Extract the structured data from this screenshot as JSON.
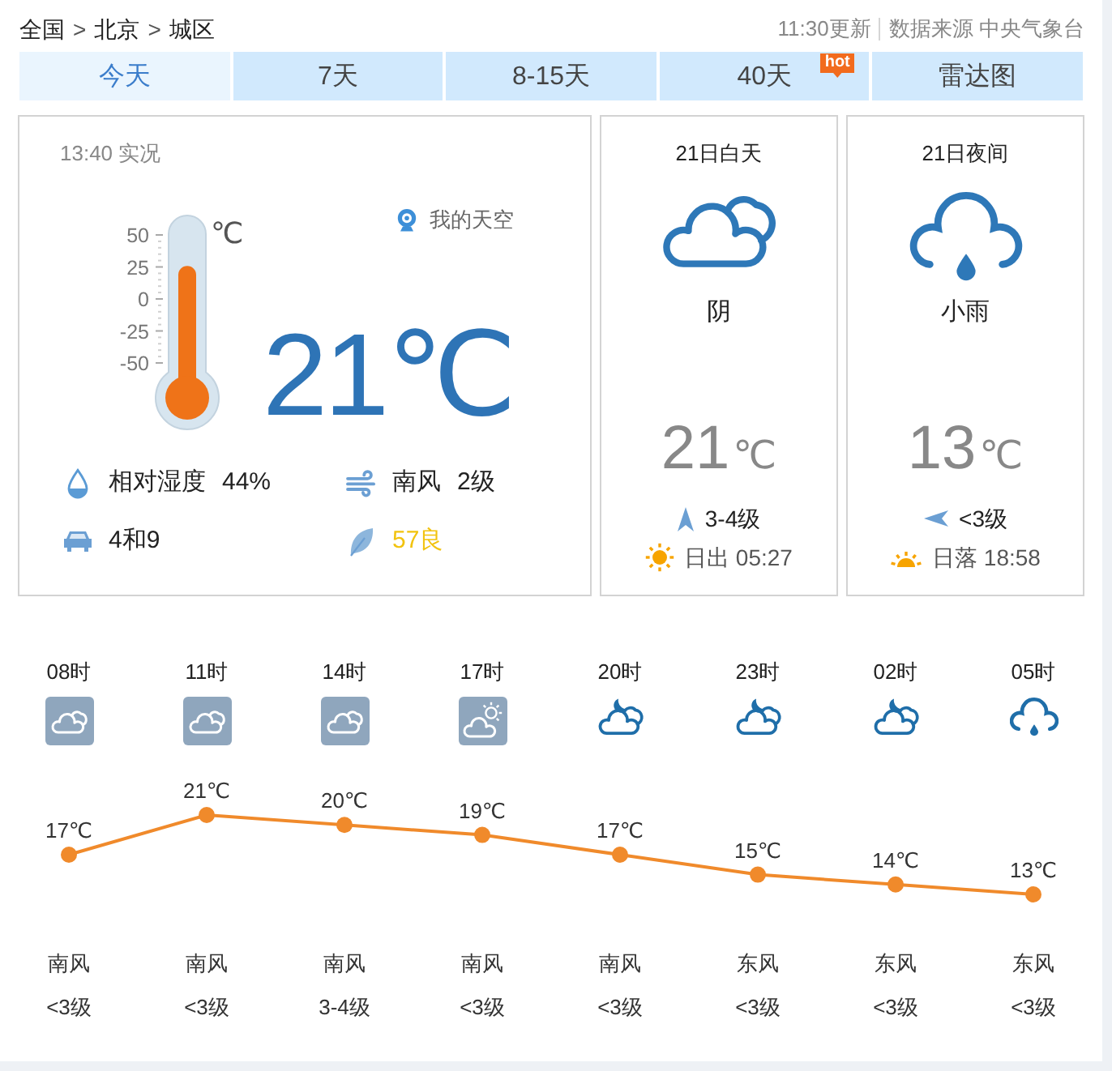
{
  "header": {
    "breadcrumb": [
      {
        "kind": "link",
        "text": "全国"
      },
      {
        "kind": "separator",
        "text": ">"
      },
      {
        "kind": "link",
        "text": "北京"
      },
      {
        "kind": "separator",
        "text": ">"
      },
      {
        "kind": "link",
        "text": "城区"
      }
    ],
    "updated": "11:30更新",
    "source": "数据来源 中央气象台"
  },
  "tabs": [
    {
      "label": "今天",
      "selected": true
    },
    {
      "label": "7天",
      "selected": false
    },
    {
      "label": "8-15天",
      "selected": false
    },
    {
      "label": "40天",
      "selected": false,
      "badge": "hot"
    },
    {
      "label": "雷达图",
      "selected": false
    }
  ],
  "current": {
    "observed": "13:40 实况",
    "thermometer": {
      "scale": [
        "50",
        "25",
        "0",
        "-25",
        "-50"
      ],
      "unit": "℃",
      "level": 0.71
    },
    "sky_link": "我的天空",
    "temperature": "21℃",
    "details": [
      {
        "kind": "humidity",
        "label": "相对湿度",
        "value": "44%"
      },
      {
        "kind": "wind",
        "label": "南风",
        "value": "2级"
      },
      {
        "kind": "traffic",
        "label": "4和9"
      },
      {
        "kind": "air",
        "label": "57良",
        "color": "#f2c30f"
      }
    ]
  },
  "periods": [
    {
      "title": "21日白天",
      "kind": "cloudy",
      "weather": "阴",
      "temperature": "21",
      "unit": "℃",
      "wind": {
        "kind": "up",
        "text": "3-4级"
      },
      "sun": {
        "kind": "sunrise",
        "text": "日出 05:27"
      }
    },
    {
      "title": "21日夜间",
      "kind": "rain",
      "weather": "小雨",
      "temperature": "13",
      "unit": "℃",
      "wind": {
        "kind": "left",
        "text": "<3级"
      },
      "sun": {
        "kind": "sunset",
        "text": "日落 18:58"
      }
    }
  ],
  "hourly": {
    "chart_data": {
      "type": "line",
      "marker": "circle",
      "categories": [
        "08时",
        "11时",
        "14时",
        "17时",
        "20时",
        "23时",
        "02时",
        "05时"
      ],
      "values": [
        17,
        21,
        20,
        19,
        17,
        15,
        14,
        13
      ],
      "value_labels": [
        "17℃",
        "21℃",
        "20℃",
        "19℃",
        "17℃",
        "15℃",
        "14℃",
        "13℃"
      ]
    },
    "columns": [
      {
        "kind": "cloudy",
        "wind": "南风",
        "wind_level": "<3级"
      },
      {
        "kind": "cloudy",
        "wind": "南风",
        "wind_level": "<3级"
      },
      {
        "kind": "cloudy",
        "wind": "南风",
        "wind_level": "3-4级"
      },
      {
        "kind": "sun-cloud",
        "wind": "南风",
        "wind_level": "<3级"
      },
      {
        "kind": "moon-cloud",
        "wind": "南风",
        "wind_level": "<3级"
      },
      {
        "kind": "moon-cloud",
        "wind": "东风",
        "wind_level": "<3级"
      },
      {
        "kind": "moon-cloud",
        "wind": "东风",
        "wind_level": "<3级"
      },
      {
        "kind": "rain",
        "wind": "东风",
        "wind_level": "<3级"
      }
    ]
  }
}
